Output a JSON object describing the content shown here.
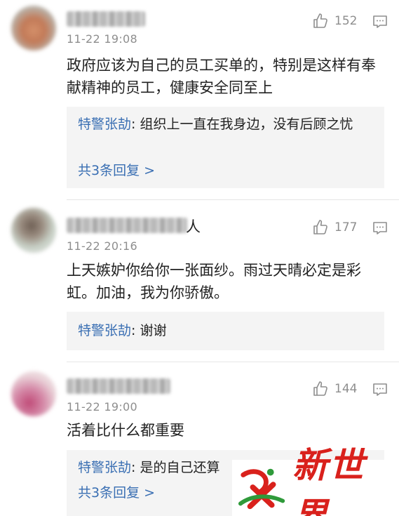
{
  "comments": [
    {
      "timestamp": "11-22 19:08",
      "likes": "152",
      "content": "政府应该为自己的员工买单的，特别是这样有奉献精神的员工，健康安全同至上",
      "reply": {
        "author": "特警张劼",
        "separator": ": ",
        "text": "组织上一直在我身边，没有后顾之忧"
      },
      "more": "共3条回复 >"
    },
    {
      "username_visible_tail": "人",
      "timestamp": "11-22 20:16",
      "likes": "177",
      "content": "上天嫉妒你给你一张面纱。雨过天晴必定是彩虹。加油，我为你骄傲。",
      "reply": {
        "author": "特警张劼",
        "separator": ": ",
        "text": "谢谢"
      }
    },
    {
      "timestamp": "11-22 19:00",
      "likes": "144",
      "content": "活着比什么都重要",
      "reply": {
        "author": "特警张劼",
        "separator": ": ",
        "text": "是的自己还算"
      },
      "more": "共3条回复 >"
    }
  ],
  "watermark": {
    "text": "新世界"
  },
  "colors": {
    "link": "#3a6fb3",
    "meta": "#8e8e8e",
    "reply_bg": "#f4f4f4",
    "watermark": "#d9211c"
  },
  "icons": {
    "like": "thumbs-up-icon",
    "reply": "comment-bubble-icon"
  }
}
